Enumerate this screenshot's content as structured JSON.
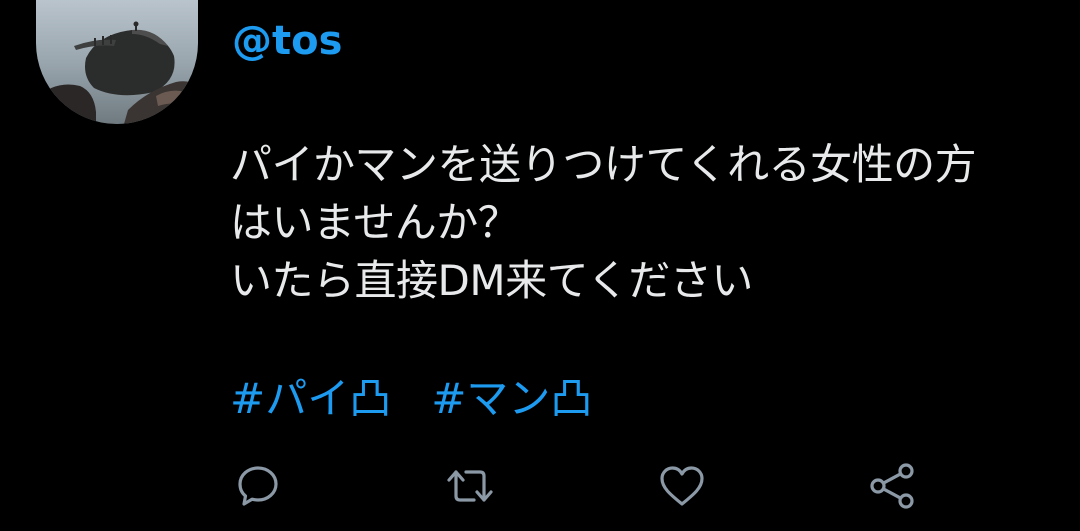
{
  "colors": {
    "background": "#000000",
    "accent": "#1d9bf0",
    "text": "#e7e9ea",
    "icon": "#8b98a5"
  },
  "author": {
    "handle": "@tos",
    "avatar_icon": "rocks-by-water-avatar"
  },
  "tweet": {
    "lines": [
      "パイかマンを送りつけてくれる女性の方",
      "はいませんか？",
      "いたら直接DM来てください"
    ],
    "hashtags": [
      "#パイ凸",
      "#マン凸"
    ]
  },
  "actions": [
    {
      "name": "reply",
      "icon": "speech-bubble-icon"
    },
    {
      "name": "retweet",
      "icon": "retweet-arrows-icon"
    },
    {
      "name": "like",
      "icon": "heart-icon"
    },
    {
      "name": "share",
      "icon": "share-nodes-icon"
    }
  ]
}
